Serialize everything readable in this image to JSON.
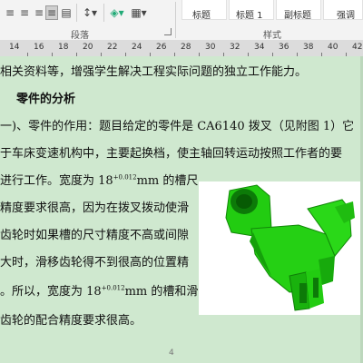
{
  "ribbon": {
    "paragraph_label": "段落",
    "styles_label": "样式",
    "styles": [
      "标题",
      "标题 1",
      "副标题",
      "强调"
    ]
  },
  "ruler": {
    "ticks": [
      "14",
      "16",
      "18",
      "20",
      "22",
      "24",
      "26",
      "28",
      "30",
      "32",
      "34",
      "36",
      "38",
      "40",
      "42"
    ]
  },
  "document": {
    "line1": "相关资料等，增强学生解决工程实际问题的独立工作能力。",
    "heading": "零件的分析",
    "line3": "一)、零件的作用：题目给定的零件是 CA6140 拨叉（见附图 1）它",
    "line4": "于车床变速机构中，主要起换档，使主轴回转运动按照工作者的要",
    "line5_pre": "进行工作。宽度为 18",
    "tol": "+0.012",
    "line5_post": "mm 的槽尺",
    "line6": "精度要求很高，因为在拨叉拨动使滑",
    "line7": "齿轮时如果槽的尺寸精度不高或间隙",
    "line8": "大时，滑移齿轮得不到很高的位置精",
    "line9_pre": "。所以，宽度为 18",
    "line9_post": "mm 的槽和滑",
    "line10": "齿轮的配合精度要求很高。",
    "page_number": "4"
  },
  "figure": {
    "part_color": "#22cc11",
    "shadow_color": "#118808"
  },
  "colors": {
    "page_bg": "#cfe8cf",
    "ribbon_bg": "#f3f3f3"
  }
}
